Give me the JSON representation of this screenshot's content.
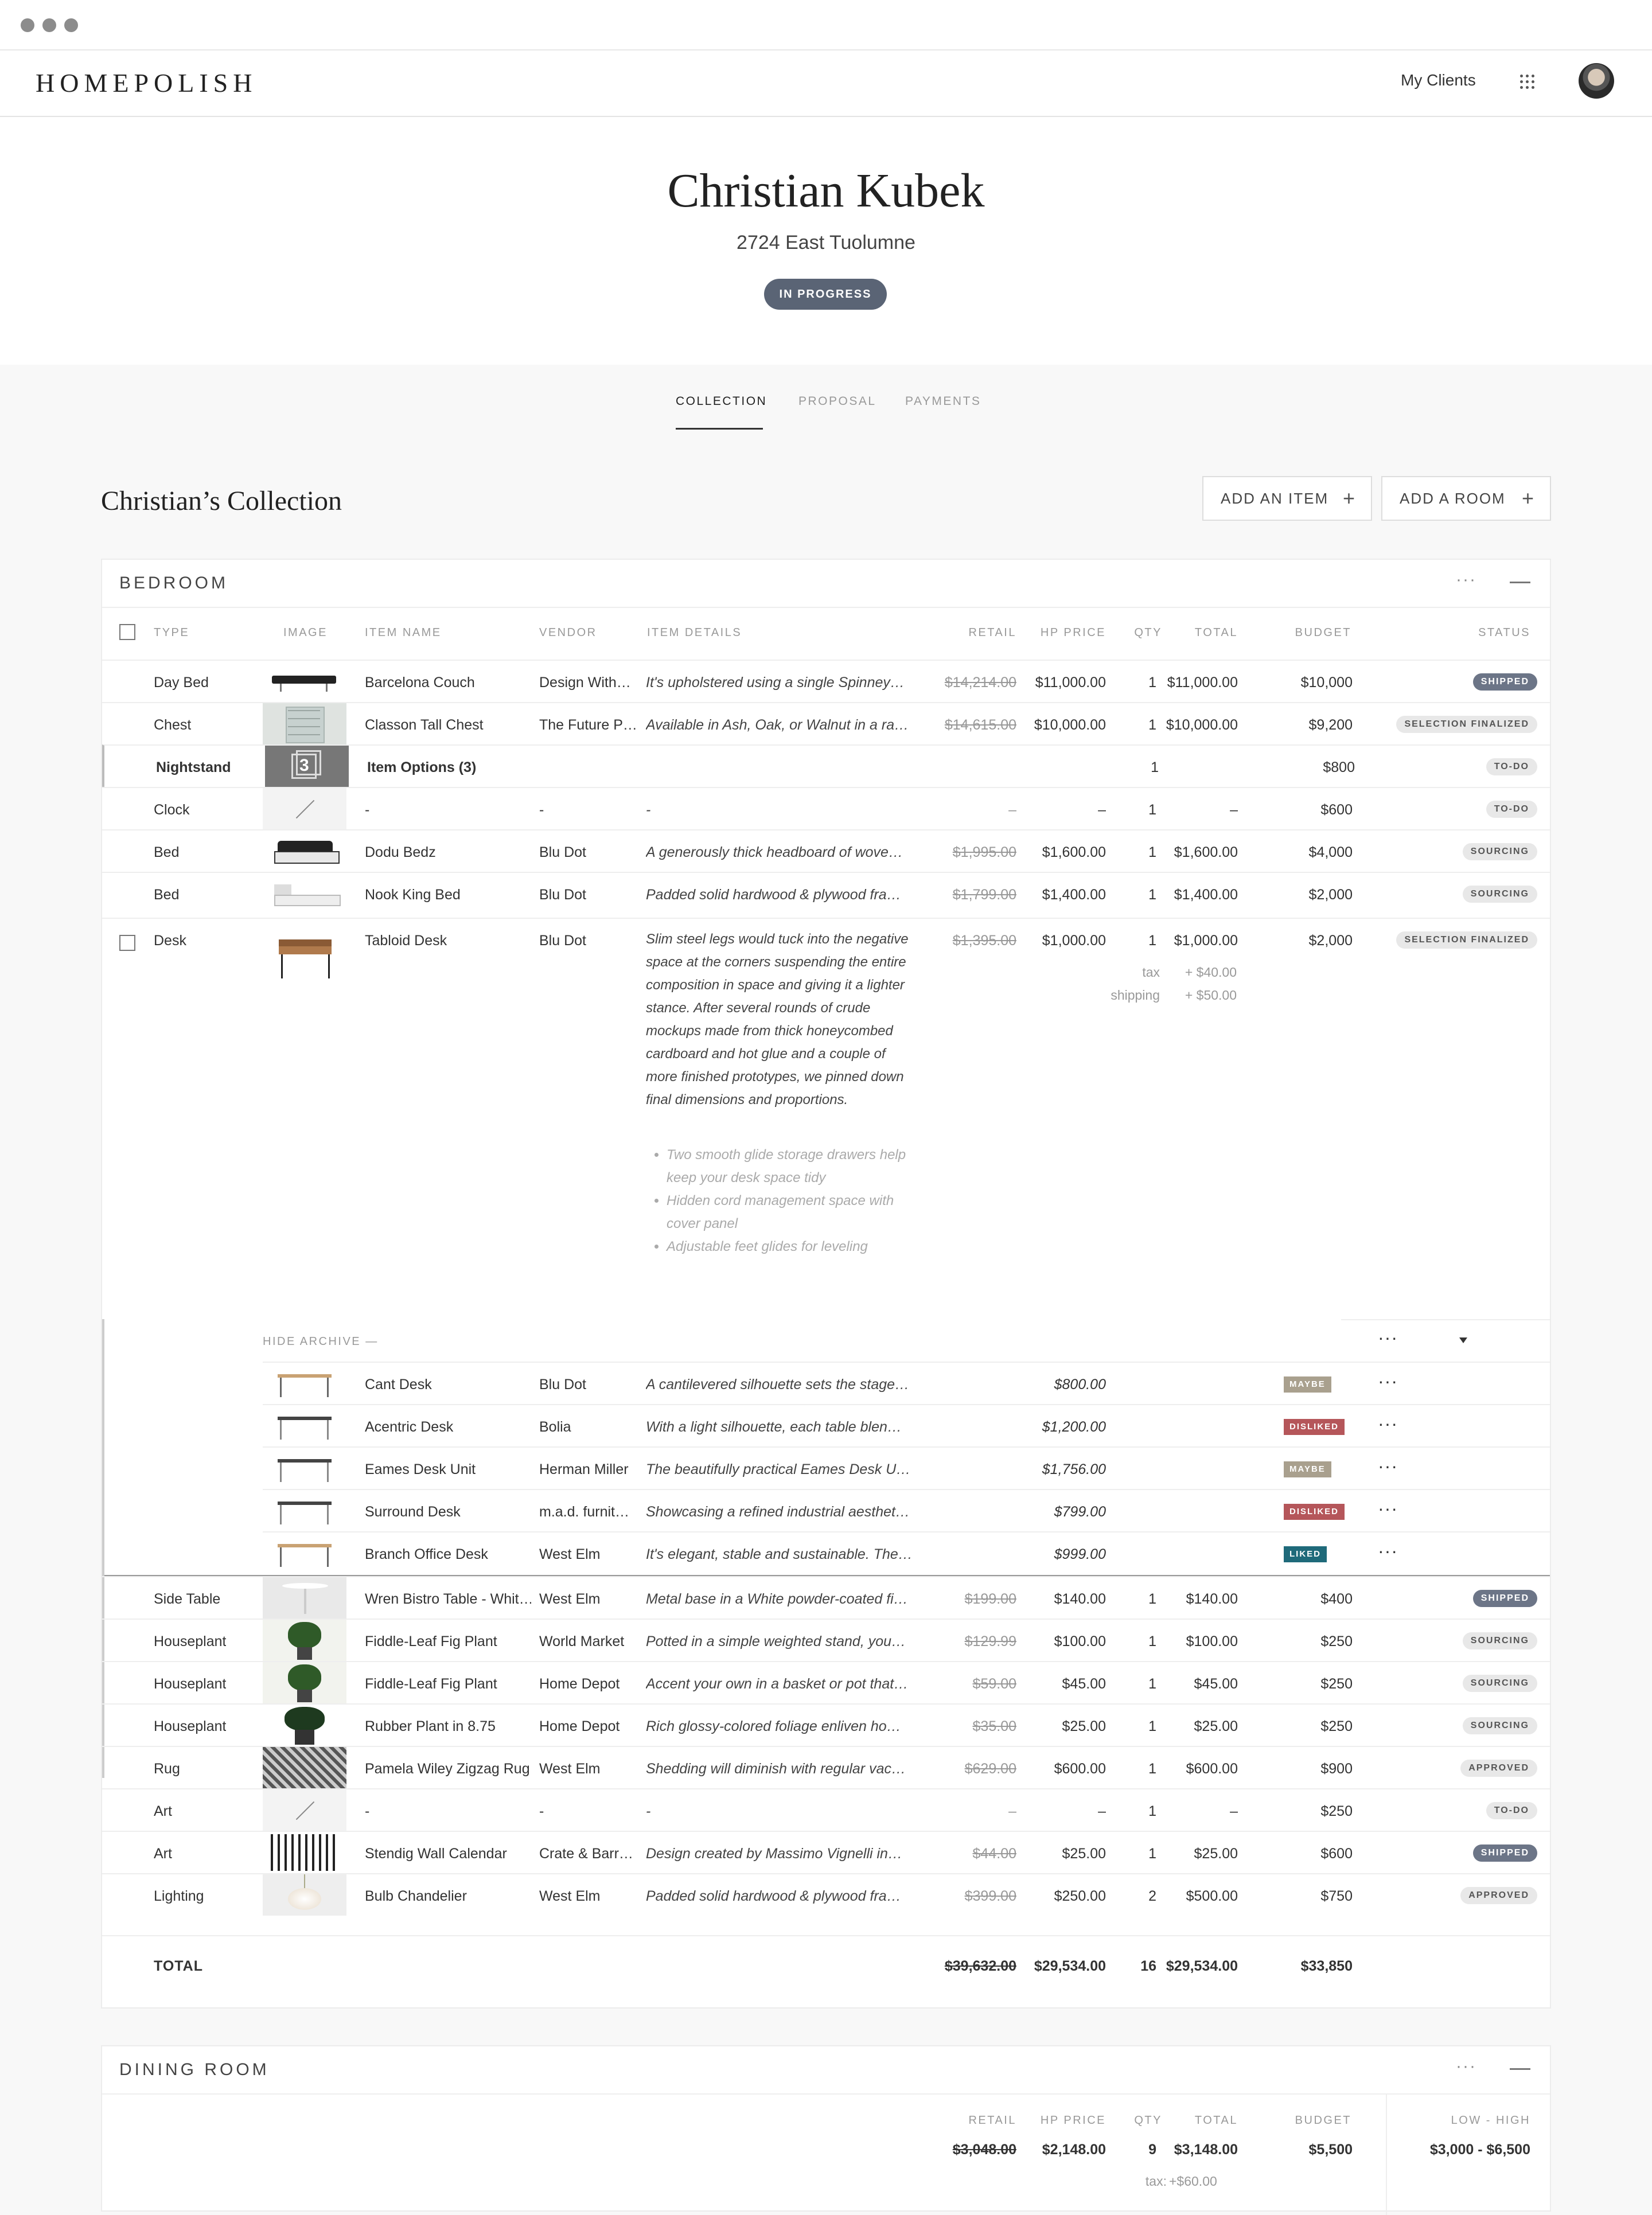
{
  "app": {
    "logo": "HOMEPOLISH",
    "my_clients": "My Clients"
  },
  "client": {
    "name": "Christian Kubek",
    "address": "2724 East Tuolumne",
    "status": "IN PROGRESS"
  },
  "tabs": [
    {
      "label": "COLLECTION",
      "active": true
    },
    {
      "label": "PROPOSAL"
    },
    {
      "label": "PAYMENTS"
    }
  ],
  "collection": {
    "title": "Christian’s Collection",
    "add_item": "ADD AN ITEM",
    "add_room": "ADD A ROOM"
  },
  "bedroom": {
    "title": "BEDROOM",
    "columns": {
      "type": "TYPE",
      "image": "IMAGE",
      "item_name": "ITEM NAME",
      "vendor": "VENDOR",
      "item_details": "ITEM DETAILS",
      "retail": "RETAIL",
      "hp_price": "HP PRICE",
      "qty": "QTY",
      "total": "TOTAL",
      "budget": "BUDGET",
      "status": "STATUS"
    },
    "rows": [
      {
        "type": "Day Bed",
        "name": "Barcelona Couch",
        "vendor": "Design With…",
        "details": "It's upholstered using a single Spinney…",
        "retail": "$14,214.00",
        "hp": "$11,000.00",
        "qty": "1",
        "total": "$11,000.00",
        "budget": "$10,000",
        "status": "SHIPPED"
      },
      {
        "type": "Chest",
        "name": "Classon Tall Chest",
        "vendor": "The Future P…",
        "details": "Available in Ash, Oak, or Walnut in a ra…",
        "retail": "$14,615.00",
        "hp": "$10,000.00",
        "qty": "1",
        "total": "$10,000.00",
        "budget": "$9,200",
        "status": "SELECTION FINALIZED"
      },
      {
        "type": "Nightstand",
        "name": "Item Options (3)",
        "vendor": "",
        "details": "",
        "retail": "",
        "hp": "",
        "qty": "1",
        "total": "",
        "budget": "$800",
        "status": "TO-DO",
        "options_count": "3"
      },
      {
        "type": "Clock",
        "name": "-",
        "vendor": "-",
        "details": "-",
        "retail": "–",
        "hp": "–",
        "qty": "1",
        "total": "–",
        "budget": "$600",
        "status": "TO-DO"
      },
      {
        "type": "Bed",
        "name": "Dodu Bedz",
        "vendor": "Blu Dot",
        "details": "A generously thick headboard of wove…",
        "retail": "$1,995.00",
        "hp": "$1,600.00",
        "qty": "1",
        "total": "$1,600.00",
        "budget": "$4,000",
        "status": "SOURCING"
      },
      {
        "type": "Bed",
        "name": "Nook King Bed",
        "vendor": "Blu Dot",
        "details": "Padded solid hardwood & plywood fra…",
        "retail": "$1,799.00",
        "hp": "$1,400.00",
        "qty": "1",
        "total": "$1,400.00",
        "budget": "$2,000",
        "status": "SOURCING"
      }
    ],
    "desk": {
      "type": "Desk",
      "name": "Tabloid Desk",
      "vendor": "Blu Dot",
      "details": "Slim steel legs would tuck into the negative space at the corners suspending the entire composition in space and giving it a lighter stance. After several rounds of crude mockups made from thick honeycombed cardboard and hot glue and a couple of more finished prototypes, we pinned down final dimensions and proportions.",
      "bullets": [
        "Two smooth glide storage drawers help keep your desk space tidy",
        "Hidden cord management space with cover panel",
        "Adjustable feet glides for leveling"
      ],
      "retail": "$1,395.00",
      "hp": "$1,000.00",
      "qty": "1",
      "total": "$1,000.00",
      "budget": "$2,000",
      "status": "SELECTION FINALIZED",
      "tax_label": "tax",
      "tax": "+ $40.00",
      "shipping_label": "shipping",
      "shipping": "+ $50.00"
    },
    "archive": {
      "toggle": "HIDE ARCHIVE —",
      "rows": [
        {
          "name": "Cant Desk",
          "vendor": "Blu Dot",
          "details": "A cantilevered silhouette sets the stage…",
          "price": "$800.00",
          "status": "MAYBE",
          "color": "#a9a08e"
        },
        {
          "name": "Acentric Desk",
          "vendor": "Bolia",
          "details": "With a light silhouette, each table blen…",
          "price": "$1,200.00",
          "status": "DISLIKED",
          "color": "#b5565a"
        },
        {
          "name": "Eames Desk Unit",
          "vendor": "Herman Miller",
          "details": "The beautifully practical Eames Desk U…",
          "price": "$1,756.00",
          "status": "MAYBE",
          "color": "#a9a08e"
        },
        {
          "name": "Surround Desk",
          "vendor": "m.a.d. furnit…",
          "details": "Showcasing a refined industrial aesthet…",
          "price": "$799.00",
          "status": "DISLIKED",
          "color": "#b5565a"
        },
        {
          "name": "Branch Office Desk",
          "vendor": "West Elm",
          "details": "It's elegant, stable and sustainable. The…",
          "price": "$999.00",
          "status": "LIKED",
          "color": "#1f6a7a"
        }
      ]
    },
    "rows2": [
      {
        "type": "Side Table",
        "name": "Wren Bistro Table - Whit…",
        "vendor": "West Elm",
        "details": "Metal base in a White powder-coated fi…",
        "retail": "$199.00",
        "hp": "$140.00",
        "qty": "1",
        "total": "$140.00",
        "budget": "$400",
        "status": "SHIPPED"
      },
      {
        "type": "Houseplant",
        "name": "Fiddle-Leaf Fig Plant",
        "vendor": "World Market",
        "details": "Potted in a simple weighted stand, you…",
        "retail": "$129.99",
        "hp": "$100.00",
        "qty": "1",
        "total": "$100.00",
        "budget": "$250",
        "status": "SOURCING"
      },
      {
        "type": "Houseplant",
        "name": "Fiddle-Leaf Fig Plant",
        "vendor": "Home Depot",
        "details": "Accent your own in a basket or pot that…",
        "retail": "$59.00",
        "hp": "$45.00",
        "qty": "1",
        "total": "$45.00",
        "budget": "$250",
        "status": "SOURCING"
      },
      {
        "type": "Houseplant",
        "name": "Rubber Plant in 8.75",
        "vendor": "Home Depot",
        "details": "Rich glossy-colored foliage enliven ho…",
        "retail": "$35.00",
        "hp": "$25.00",
        "qty": "1",
        "total": "$25.00",
        "budget": "$250",
        "status": "SOURCING"
      },
      {
        "type": "Rug",
        "name": "Pamela Wiley Zigzag Rug",
        "vendor": "West Elm",
        "details": "Shedding will diminish with regular vac…",
        "retail": "$629.00",
        "hp": "$600.00",
        "qty": "1",
        "total": "$600.00",
        "budget": "$900",
        "status": "APPROVED"
      },
      {
        "type": "Art",
        "name": "-",
        "vendor": "-",
        "details": "-",
        "retail": "–",
        "hp": "–",
        "qty": "1",
        "total": "–",
        "budget": "$250",
        "status": "TO-DO"
      },
      {
        "type": "Art",
        "name": "Stendig Wall Calendar",
        "vendor": "Crate & Barr…",
        "details": "Design created by Massimo Vignelli in…",
        "retail": "$44.00",
        "hp": "$25.00",
        "qty": "1",
        "total": "$25.00",
        "budget": "$600",
        "status": "SHIPPED"
      },
      {
        "type": "Lighting",
        "name": "Bulb Chandelier",
        "vendor": "West Elm",
        "details": "Padded solid hardwood & plywood fra…",
        "retail": "$399.00",
        "hp": "$250.00",
        "qty": "2",
        "total": "$500.00",
        "budget": "$750",
        "status": "APPROVED"
      }
    ],
    "total": {
      "label": "TOTAL",
      "retail": "$39,632.00",
      "hp": "$29,534.00",
      "qty": "16",
      "total": "$29,534.00",
      "budget": "$33,850"
    }
  },
  "dining": {
    "title": "DINING ROOM",
    "columns": {
      "retail": "RETAIL",
      "hp_price": "HP PRICE",
      "qty": "QTY",
      "total": "TOTAL",
      "budget": "BUDGET",
      "low_high": "LOW - HIGH"
    },
    "values": {
      "retail": "$3,048.00",
      "hp": "$2,148.00",
      "qty": "9",
      "total": "$3,148.00",
      "budget": "$5,500",
      "low_high": "$3,000 - $6,500"
    },
    "tax_label": "tax:",
    "tax": "+$60.00"
  }
}
